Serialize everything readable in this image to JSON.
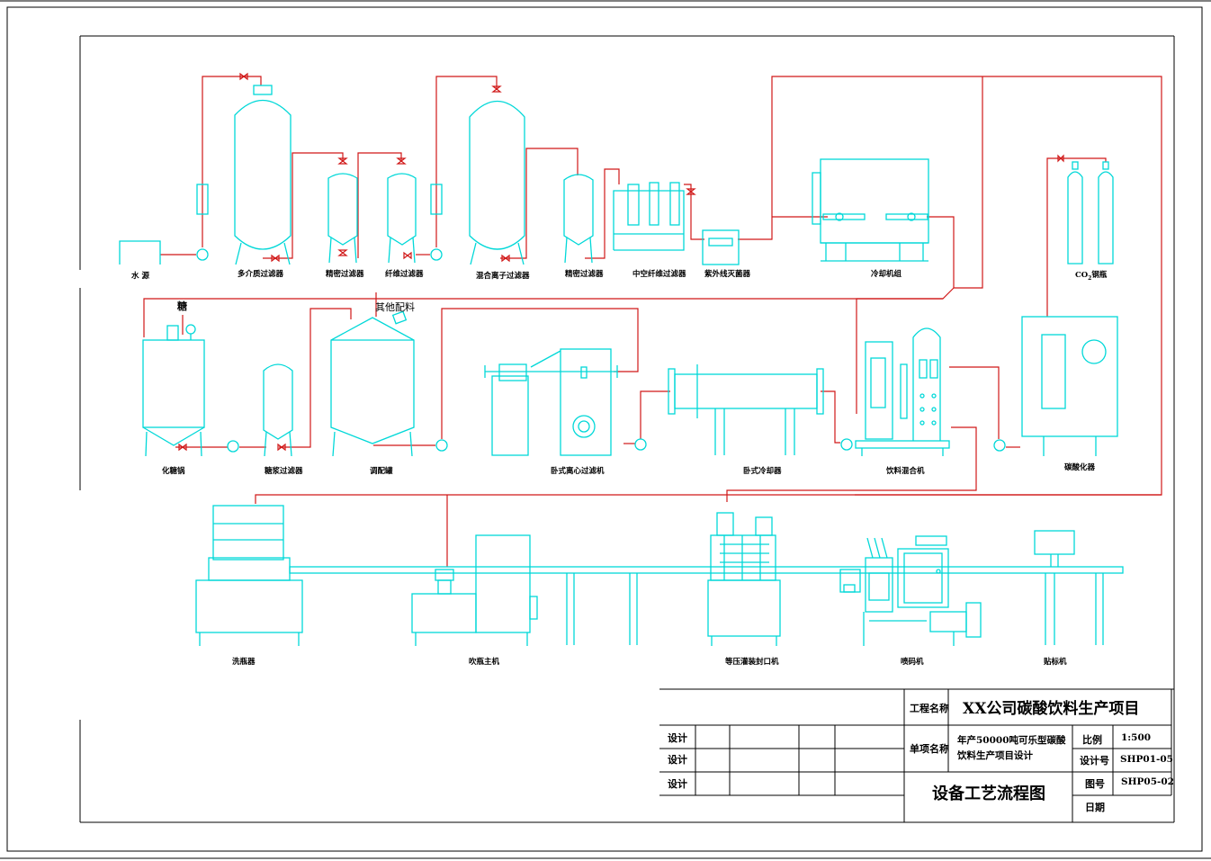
{
  "equipment_labels": {
    "water_source": "水 源",
    "multi_media_filter": "多介质过滤器",
    "precision_filter_1": "精密过滤器",
    "fiber_filter": "纤维过滤器",
    "mixed_ion_filter": "混合离子过滤器",
    "precision_filter_2": "精密过滤器",
    "hollow_fiber_filter": "中空纤维过滤器",
    "uv_sterilizer": "紫外线灭菌器",
    "chiller": "冷却机组",
    "co2_cylinder_prefix": "CO",
    "co2_cylinder_sub": "2",
    "co2_cylinder_suffix": "钢瓶",
    "sugar_tank": "化糖锅",
    "syrup_filter": "糖浆过滤器",
    "blending_tank": "调配罐",
    "centrifugal_filter": "卧式离心过滤机",
    "horizontal_cooler": "卧式冷却器",
    "beverage_mixer": "饮料混合机",
    "carbonator": "碳酸化器",
    "bottle_washer": "洗瓶器",
    "blow_molder": "吹瓶主机",
    "filler_capper": "等压灌装封口机",
    "coder": "喷码机",
    "labeler": "贴标机",
    "sugar_input": "糖",
    "other_ingredients": "其他配料"
  },
  "title_block": {
    "project_name_label": "工程名称",
    "project_name": "XX公司碳酸饮料生产项目",
    "sub_project_label": "单项名称",
    "sub_project_line1": "年产50000吨可乐型碳酸",
    "sub_project_line2": "饮料生产项目设计",
    "drawing_title": "设备工艺流程图",
    "scale_label": "比例",
    "scale_value": "1:500",
    "design_no_label": "设计号",
    "design_no_value": "SHP01-05",
    "drawing_no_label": "图号",
    "drawing_no_value": "SHP05-02",
    "date_label": "日期",
    "row_labels": [
      "设计",
      "设计",
      "设计"
    ]
  },
  "colors": {
    "equipment": "#00d8d8",
    "pipe": "#d01818",
    "frame": "#000000"
  }
}
